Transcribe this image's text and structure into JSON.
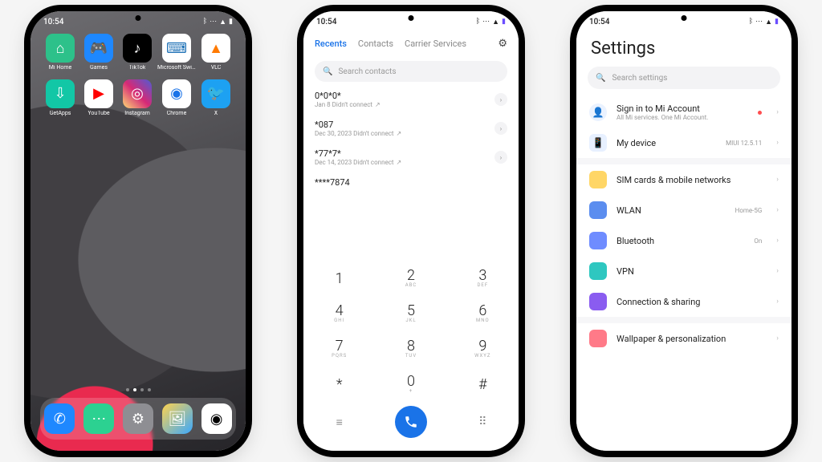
{
  "status": {
    "time": "10:54"
  },
  "home": {
    "apps": [
      {
        "label": "Mi Home",
        "bg": "#2dc18a",
        "glyph": "⌂"
      },
      {
        "label": "Games",
        "bg": "#1e88ff",
        "glyph": "🎮"
      },
      {
        "label": "TikTok",
        "bg": "#000",
        "glyph": "♪"
      },
      {
        "label": "Microsoft SwiftKey …",
        "bg": "#fff",
        "glyph": "⌨",
        "fg": "#1a6fb5"
      },
      {
        "label": "VLC",
        "bg": "#fff",
        "glyph": "▲",
        "fg": "#ff7a00"
      },
      {
        "label": "GetApps",
        "bg": "#12c7a6",
        "glyph": "⇩"
      },
      {
        "label": "YouTube",
        "bg": "#fff",
        "glyph": "▶",
        "fg": "#ff0000"
      },
      {
        "label": "Instagram",
        "bg": "linear-gradient(45deg,#feda75,#d62976,#4f5bd5)",
        "glyph": "◎"
      },
      {
        "label": "Chrome",
        "bg": "#fff",
        "glyph": "◉",
        "fg": "#1a73e8"
      },
      {
        "label": "X",
        "bg": "#1da1f2",
        "glyph": "🐦"
      }
    ],
    "dock": [
      {
        "bg": "#1e88ff",
        "glyph": "✆"
      },
      {
        "bg": "#2cd191",
        "glyph": "⋯"
      },
      {
        "bg": "#8e8e93",
        "glyph": "⚙"
      },
      {
        "bg": "linear-gradient(135deg,#ffd24d,#3aa9ff)",
        "glyph": "🖼"
      },
      {
        "bg": "#fff",
        "glyph": "◉",
        "fg": "#000"
      }
    ]
  },
  "phone": {
    "tabs": [
      "Recents",
      "Contacts",
      "Carrier Services"
    ],
    "active_tab": 0,
    "search_placeholder": "Search contacts",
    "recents": [
      {
        "number": "0*0*0*",
        "sub": "Jan 8 Didn't connect"
      },
      {
        "number": "*087",
        "sub": "Dec 30, 2023 Didn't connect"
      },
      {
        "number": "*77*7*",
        "sub": "Dec 14, 2023 Didn't connect"
      },
      {
        "number": "****7874",
        "sub": ""
      }
    ],
    "keys": [
      [
        "1",
        ""
      ],
      [
        "2",
        "ABC"
      ],
      [
        "3",
        "DEF"
      ],
      [
        "4",
        "GHI"
      ],
      [
        "5",
        "JKL"
      ],
      [
        "6",
        "MNO"
      ],
      [
        "7",
        "PQRS"
      ],
      [
        "8",
        "TUV"
      ],
      [
        "9",
        "WXYZ"
      ],
      [
        "*",
        ""
      ],
      [
        "0",
        "+"
      ],
      [
        "#",
        ""
      ]
    ]
  },
  "settings": {
    "title": "Settings",
    "search_placeholder": "Search settings",
    "account": {
      "label": "Sign in to Mi Account",
      "sub": "All Mi services. One Mi Account."
    },
    "device": {
      "label": "My device",
      "value": "MIUI 12.5.11"
    },
    "items": [
      {
        "icon_bg": "#ffd666",
        "label": "SIM cards & mobile networks",
        "value": ""
      },
      {
        "icon_bg": "#5b8def",
        "label": "WLAN",
        "value": "Home-5G"
      },
      {
        "icon_bg": "#6f8cff",
        "label": "Bluetooth",
        "value": "On"
      },
      {
        "icon_bg": "#2ec7c0",
        "label": "VPN",
        "value": ""
      },
      {
        "icon_bg": "#8a5cf0",
        "label": "Connection & sharing",
        "value": ""
      },
      {
        "icon_bg": "#ff7a88",
        "label": "Wallpaper & personalization",
        "value": ""
      }
    ]
  }
}
